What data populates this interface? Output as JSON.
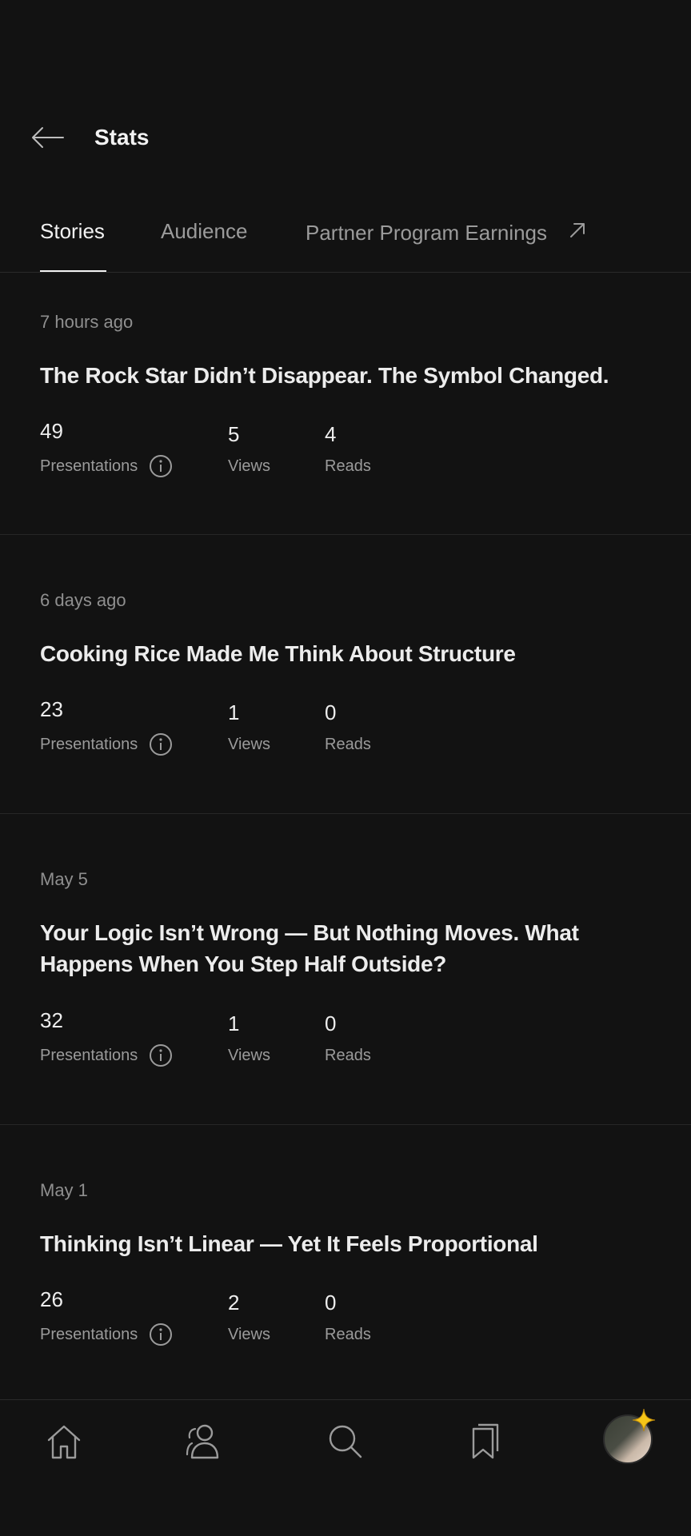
{
  "header": {
    "title": "Stats"
  },
  "tabs": [
    {
      "label": "Stories"
    },
    {
      "label": "Audience"
    },
    {
      "label": "Partner Program Earnings"
    }
  ],
  "stat_labels": {
    "presentations": "Presentations",
    "views": "Views",
    "reads": "Reads"
  },
  "stories": [
    {
      "date": "7 hours ago",
      "title": "The Rock Star Didn’t Disappear. The Symbol Changed.",
      "presentations": "49",
      "views": "5",
      "reads": "4"
    },
    {
      "date": "6 days ago",
      "title": "Cooking Rice Made Me Think About Structure",
      "presentations": "23",
      "views": "1",
      "reads": "0"
    },
    {
      "date": "May 5",
      "title": "Your Logic Isn’t Wrong — But Nothing Moves. What Happens When You Step Half Outside?",
      "presentations": "32",
      "views": "1",
      "reads": "0"
    },
    {
      "date": "May 1",
      "title": "Thinking Isn’t Linear — Yet It Feels Proportional",
      "presentations": "26",
      "views": "2",
      "reads": "0"
    }
  ],
  "bottom_nav": [
    "home-icon",
    "following-icon",
    "search-icon",
    "bookmarks-icon",
    "profile-avatar"
  ]
}
